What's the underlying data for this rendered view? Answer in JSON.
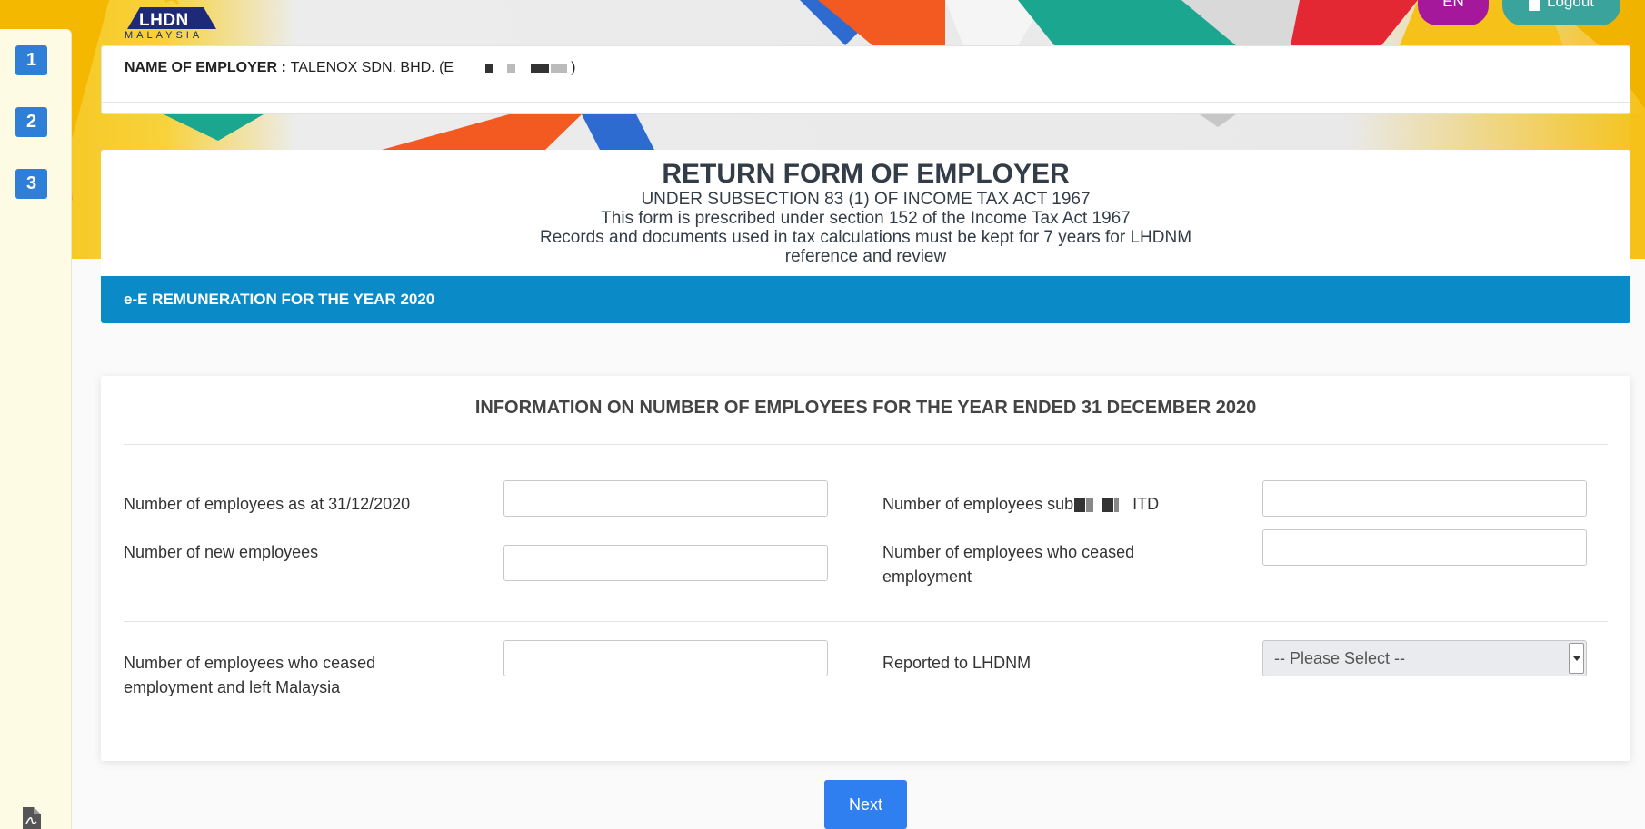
{
  "header": {
    "logo_text": "LHDN",
    "logo_sub": "MALAYSIA",
    "lang_label": "EN",
    "logout_label": "Logout"
  },
  "steps": [
    "1",
    "2",
    "3"
  ],
  "employer": {
    "label": "NAME OF EMPLOYER :",
    "name_prefix": "TALENOX SDN. BHD. (E",
    "name_suffix": ")"
  },
  "form_header": {
    "title": "RETURN FORM OF EMPLOYER",
    "subsection": "UNDER SUBSECTION 83 (1) OF INCOME TAX ACT 1967",
    "prescribed": "This form is prescribed under section 152 of the Income Tax Act 1967",
    "records": "Records and documents used in tax calculations must be kept for 7 years for LHDNM reference and review"
  },
  "remuneration_bar": "e-E REMUNERATION FOR THE YEAR 2020",
  "section": {
    "title": "INFORMATION ON NUMBER OF EMPLOYEES FOR THE YEAR ENDED 31 DECEMBER 2020",
    "fields": {
      "employees_at_year_end": {
        "label": "Number of employees as at 31/12/2020",
        "value": ""
      },
      "employees_sub_itd": {
        "label_prefix": "Number of employees sub",
        "label_suffix": "ITD",
        "value": ""
      },
      "new_employees": {
        "label": "Number of new employees",
        "value": ""
      },
      "ceased_employment": {
        "label": "Number of employees who ceased employment",
        "value": ""
      },
      "ceased_left_malaysia": {
        "label": "Number of employees who ceased employment and left Malaysia",
        "value": ""
      },
      "reported_to_lhdnm": {
        "label": "Reported to LHDNM",
        "selected": "-- Please Select --"
      }
    }
  },
  "actions": {
    "next_label": "Next"
  },
  "colors": {
    "primary_blue": "#2f7fd8",
    "bar_blue": "#0a8ac6",
    "lang_purple": "#a5179b",
    "logout_teal": "#3aa39c",
    "rail_bg": "#fdfbe3"
  }
}
